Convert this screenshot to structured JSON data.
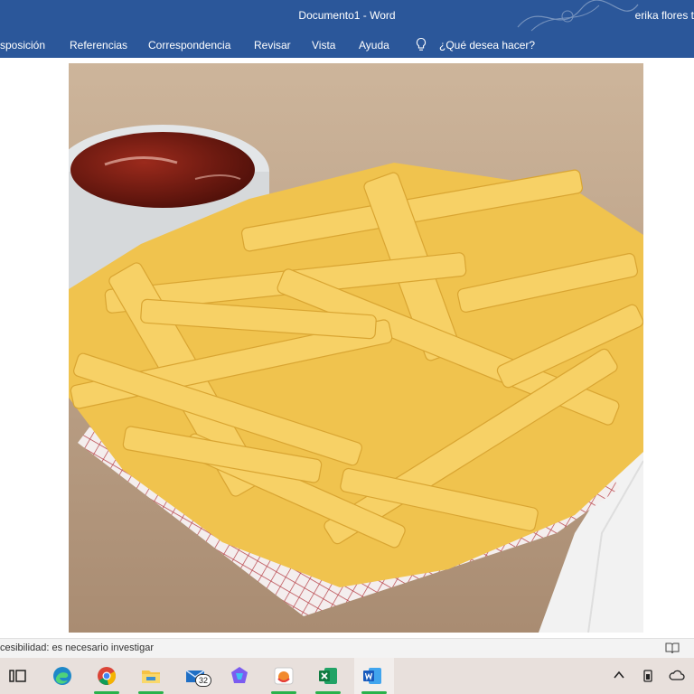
{
  "titlebar": {
    "title": "Documento1  -  Word",
    "user": "erika flores t"
  },
  "ribbon": {
    "tabs": [
      "sposición",
      "Referencias",
      "Correspondencia",
      "Revisar",
      "Vista",
      "Ayuda"
    ],
    "search_placeholder": "¿Qué desea hacer?"
  },
  "statusbar": {
    "accessibility": "cesibilidad: es necesario investigar"
  },
  "taskbar": {
    "mail_badge": "32",
    "apps": [
      "task-view",
      "edge",
      "chrome",
      "file-explorer",
      "mail",
      "copilot",
      "photos",
      "excel",
      "word"
    ]
  },
  "colors": {
    "ribbon": "#2b579a",
    "taskbar": "#e8e0dc",
    "indicator": "#2bb24c"
  }
}
